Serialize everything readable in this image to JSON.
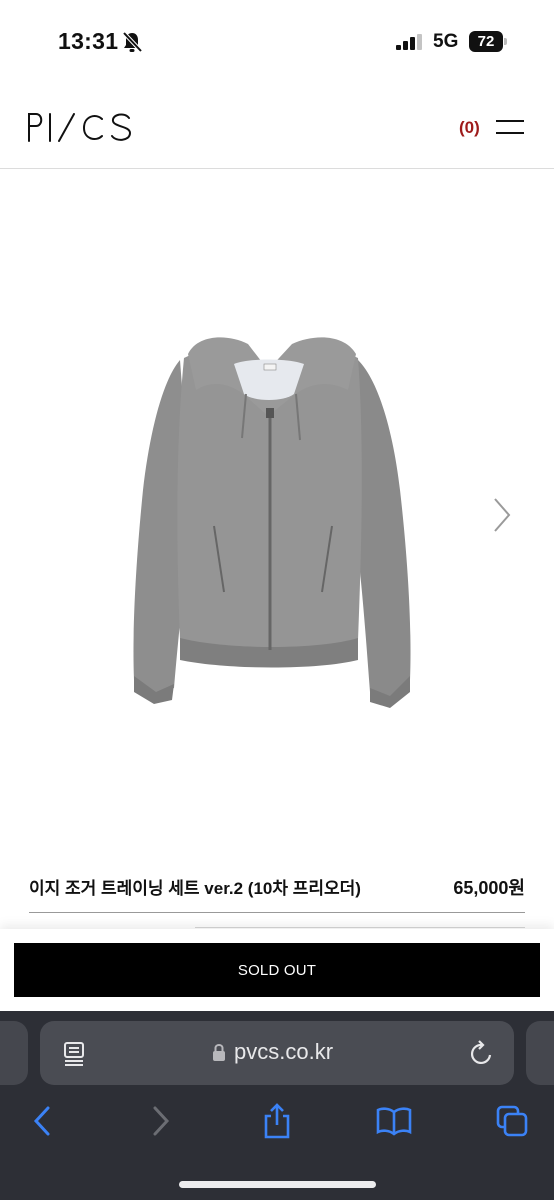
{
  "status_bar": {
    "time": "13:31",
    "network": "5G",
    "battery": "72",
    "icons": [
      "bell-slash-icon",
      "signal-icon"
    ]
  },
  "header": {
    "logo": "PVCS",
    "cart_count": "(0)",
    "cart_color": "#9e1b1b",
    "icons": [
      "menu-icon"
    ]
  },
  "product": {
    "image": "gray-zip-hoodie",
    "name": "이지 조거 트레이닝 세트 ver.2 (10차 프리오더)",
    "price": "65,000원"
  },
  "actions": {
    "soldout_label": "SOLD OUT"
  },
  "browser": {
    "url": "pvcs.co.kr",
    "background": "#2d2f36",
    "accent": "#3b82f6",
    "icons": [
      "reader-icon",
      "lock-icon",
      "reload-icon",
      "back-icon",
      "forward-icon",
      "share-icon",
      "bookmarks-icon",
      "tabs-icon"
    ]
  }
}
